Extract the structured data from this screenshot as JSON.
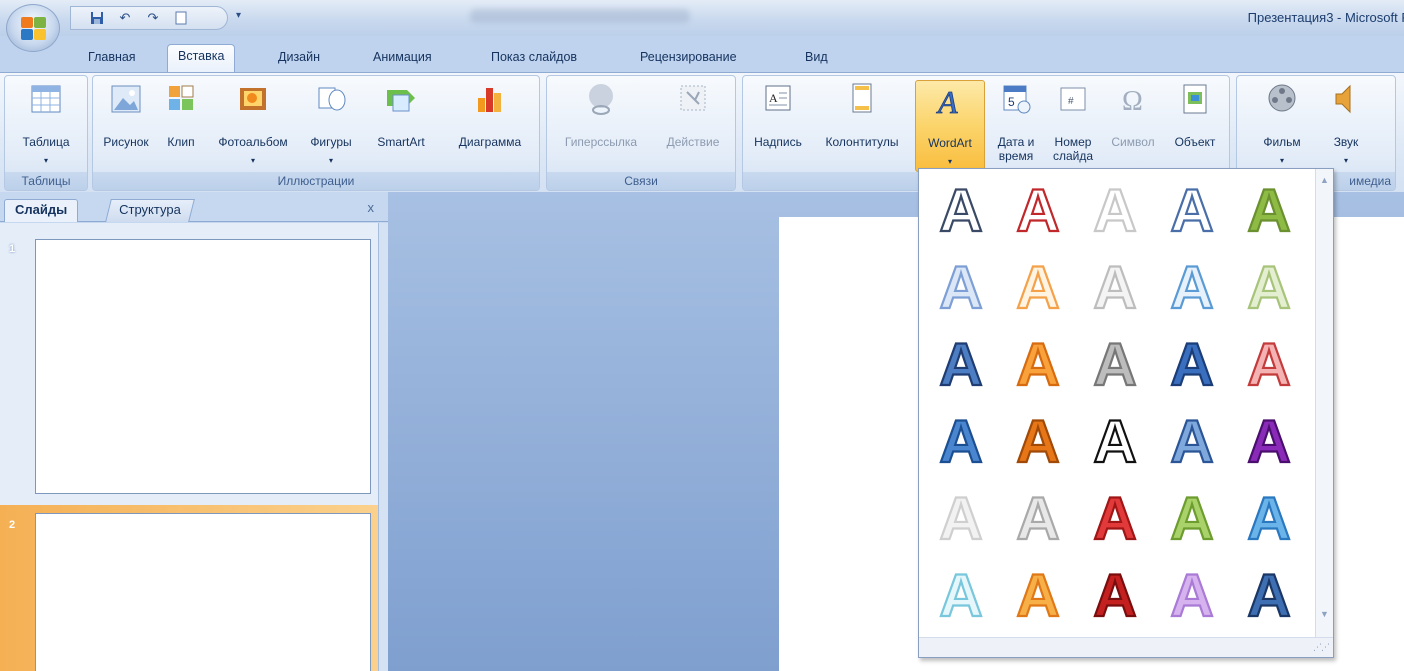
{
  "window": {
    "title": "Презентация3 - Microsoft P"
  },
  "quick_access": {
    "icons": [
      "save-icon",
      "undo-icon",
      "redo-icon",
      "new-icon"
    ],
    "dropdown": "▾"
  },
  "tabs": [
    {
      "label": "Главная",
      "active": false
    },
    {
      "label": "Вставка",
      "active": true
    },
    {
      "label": "Дизайн",
      "active": false
    },
    {
      "label": "Анимация",
      "active": false
    },
    {
      "label": "Показ слайдов",
      "active": false
    },
    {
      "label": "Рецензирование",
      "active": false
    },
    {
      "label": "Вид",
      "active": false
    }
  ],
  "ribbon": {
    "groups": [
      {
        "label": "Таблицы",
        "buttons": [
          {
            "label": "Таблица",
            "icon": "table-icon",
            "dropdown": "▾"
          }
        ]
      },
      {
        "label": "Иллюстрации",
        "buttons": [
          {
            "label": "Рисунок",
            "icon": "picture-icon"
          },
          {
            "label": "Клип",
            "icon": "clipart-icon"
          },
          {
            "label": "Фотоальбом",
            "icon": "photo-album-icon",
            "dropdown": "▾"
          },
          {
            "label": "Фигуры",
            "icon": "shapes-icon",
            "dropdown": "▾"
          },
          {
            "label": "SmartArt",
            "icon": "smartart-icon"
          },
          {
            "label": "Диаграмма",
            "icon": "chart-icon"
          }
        ]
      },
      {
        "label": "Связи",
        "buttons": [
          {
            "label": "Гиперссылка",
            "icon": "hyperlink-icon",
            "disabled": true
          },
          {
            "label": "Действие",
            "icon": "action-icon",
            "disabled": true
          }
        ]
      },
      {
        "label": "",
        "buttons": [
          {
            "label": "Надпись",
            "icon": "textbox-icon"
          },
          {
            "label": "Колонтитулы",
            "icon": "header-footer-icon"
          },
          {
            "label": "WordArt",
            "icon": "wordart-icon",
            "dropdown": "▾",
            "active": true
          },
          {
            "label": "Дата и",
            "label2": "время",
            "icon": "date-time-icon"
          },
          {
            "label": "Номер",
            "label2": "слайда",
            "icon": "slide-number-icon"
          },
          {
            "label": "Символ",
            "icon": "symbol-icon",
            "disabled": true
          },
          {
            "label": "Объект",
            "icon": "object-icon"
          }
        ]
      },
      {
        "label": "имедиа",
        "buttons": [
          {
            "label": "Фильм",
            "icon": "movie-icon",
            "dropdown": "▾"
          },
          {
            "label": "Звук",
            "icon": "sound-icon",
            "dropdown": "▾"
          }
        ]
      }
    ]
  },
  "left_pane": {
    "tab_slides": "Слайды",
    "tab_outline": "Структура",
    "close": "x",
    "slides": [
      {
        "number": "1",
        "selected": false
      },
      {
        "number": "2",
        "selected": true
      }
    ]
  },
  "wordart_gallery": {
    "glyph": "A",
    "styles": [
      [
        "#ffffff|#3a4a66",
        "#ffffff|#c0282c",
        "#ffffff|#c8c8c8",
        "#ffffff|#4a6ea8",
        "#8dbb44|#6a9030"
      ],
      [
        "#dbe6f6|#7d9fd6",
        "#fff3e2|#f4a14a",
        "#f4f4f4|#bdbdbd",
        "#e6f1fb|#5b9bd5",
        "#e4efd2|#a7c47a"
      ],
      [
        "#4d7dc2|#1f3d72",
        "#f9a13a|#d66b10",
        "#bdbdbd|#777777",
        "#3a6fc0|#1b3d78",
        "#f4b2b2|#c43b3b"
      ],
      [
        "#4a86d0|#1c4f92",
        "#e67617|#a14a07",
        "#ffffff|#111111",
        "#7fa8dc|#2b5596",
        "#8a2ab8|#4a0f6e"
      ],
      [
        "#f2f2f2|#cfcfcf",
        "#e8e8e8|#a9a9a9",
        "#e23a3a|#a01616",
        "#a9d36a|#6d9d2e",
        "#6ab4ea|#2a78c0"
      ],
      [
        "#e6f7fc|#78c7dc",
        "#f7b048|#e07818",
        "#c42020|#7a0d0d",
        "#d6b3ee|#a97ad6",
        "#3e6fb3|#1b3766"
      ]
    ]
  },
  "colors": {
    "accent": "#fbd46b",
    "ribbon": "#dfe9f6",
    "workspace": "#8fa9d4"
  }
}
